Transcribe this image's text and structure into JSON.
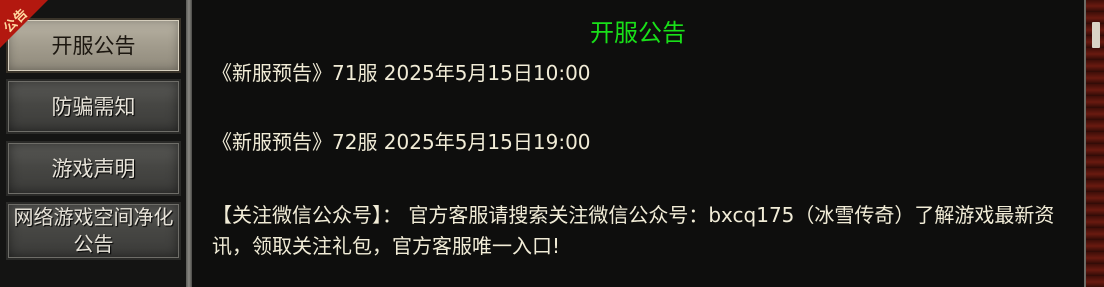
{
  "sidebar": {
    "badge": "公告",
    "tabs": [
      {
        "label": "开服公告",
        "active": true
      },
      {
        "label": "防骗需知",
        "active": false
      },
      {
        "label": "游戏声明",
        "active": false
      },
      {
        "label": "网络游戏空间净化公告",
        "active": false
      }
    ]
  },
  "content": {
    "title": "开服公告",
    "announcements": [
      "《新服预告》71服 2025年5月15日10:00",
      "《新服预告》72服 2025年5月15日19:00"
    ],
    "notice": "【关注微信公众号】： 官方客服请搜索关注微信公众号：bxcq175（冰雪传奇）了解游戏最新资讯，领取关注礼包，官方客服唯一入口!"
  },
  "colors": {
    "title": "#19e019",
    "text": "#f1ecd7",
    "badge": "#b3180f",
    "background": "#0e0e0d"
  }
}
